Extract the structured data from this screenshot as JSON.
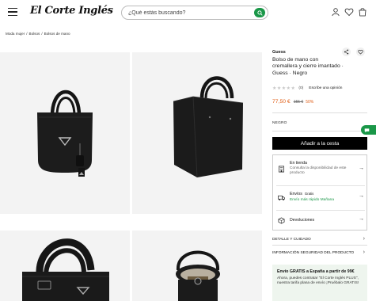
{
  "header": {
    "logo_text": "El Corte Inglés",
    "search_placeholder": "¿Qué estás buscando?"
  },
  "breadcrumb": [
    "Moda mujer",
    "Bolsos",
    "Bolsos de mano"
  ],
  "product": {
    "brand": "Guess",
    "title": "Bolso de mano con cremallera y cierre imantado · Guess · Negro",
    "rating_stars": "★★★★★",
    "rating_count": "(0)",
    "review_link": "Escribe una opinión",
    "price": "77,50 €",
    "old_price": "155 €",
    "discount": "50%",
    "color": "NEGRO",
    "add_to_cart": "Añadir a la cesta"
  },
  "options": {
    "store_title": "En tienda",
    "store_sub": "Consulta la disponibilidad de este producto",
    "shipping_title": "Envíos",
    "shipping_badge": "Gratis",
    "shipping_sub": "Envío más rápido Mañana",
    "returns_title": "Devoluciones"
  },
  "accordions": {
    "detail": "DETALLE Y CUIDADO",
    "safety": "INFORMACIÓN SEGURIDAD DEL PRODUCTO"
  },
  "shipping_banner": {
    "title": "Envío GRATIS a España a partir de 99€",
    "text": "Ahora, puedes contratar \"El Corte Inglés PLUS\", nuestra tarifa plana de envío ¡Pruébalo GRATIS!"
  },
  "colors": {
    "accent_green": "#1a9748",
    "price_orange": "#e0601a",
    "button_black": "#000000",
    "banner_bg": "#eef5ee"
  }
}
